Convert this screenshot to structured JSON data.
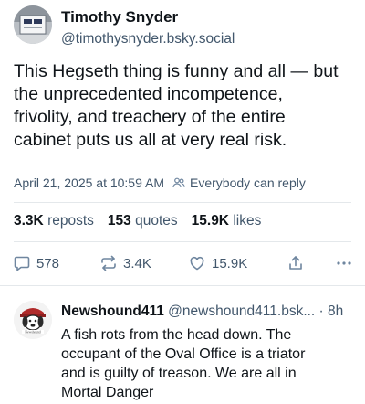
{
  "post": {
    "author": {
      "name": "Timothy Snyder",
      "handle": "@timothysnyder.bsky.social"
    },
    "text_lines": [
      "This Hegseth thing is funny and all — but",
      "the unprecedented incompetence,",
      "frivolity, and treachery of the entire",
      "cabinet puts us all at very real risk."
    ],
    "timestamp": "April 21, 2025 at 10:59 AM",
    "reply_setting": "Everybody can reply",
    "stats": {
      "reposts_count": "3.3K",
      "reposts_label": "reposts",
      "quotes_count": "153",
      "quotes_label": "quotes",
      "likes_count": "15.9K",
      "likes_label": "likes"
    },
    "actions": {
      "reply_count": "578",
      "repost_count": "3.4K",
      "like_count": "15.9K"
    },
    "icons": {
      "reply": "comment-icon",
      "repost": "repost-icon",
      "like": "heart-icon",
      "share": "share-icon",
      "more": "more-icon",
      "reply_setting": "people-icon"
    }
  },
  "reply": {
    "author_name": "Newshound411",
    "author_handle": "@newshound411.bsk...",
    "separator": " · ",
    "time": "8h",
    "text_lines": [
      "A fish rots from the head down. The",
      "occupant of the Oval Office is a triator",
      "and is guilty of treason. We are all in",
      "Mortal Danger"
    ]
  },
  "colors": {
    "text": "#0f1419",
    "muted": "#42576c",
    "icon": "#6f869f",
    "divider": "#e4e8eb"
  }
}
